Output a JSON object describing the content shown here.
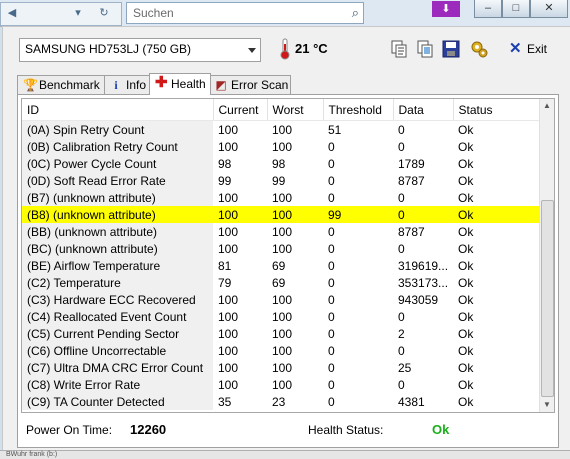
{
  "background": {
    "search_placeholder": "Suchen",
    "bottom_fragment": "BWuhr frank (b:)"
  },
  "toolbar": {
    "drive": "SAMSUNG HD753LJ (750 GB)",
    "temperature": "21 °C",
    "exit_label": "Exit"
  },
  "tabs": [
    {
      "label": "Benchmark",
      "icon": "trophy-icon"
    },
    {
      "label": "Info",
      "icon": "info-icon"
    },
    {
      "label": "Health",
      "icon": "health-cross-icon"
    },
    {
      "label": "Error Scan",
      "icon": "error-scan-icon"
    }
  ],
  "table": {
    "headers": [
      "ID",
      "Current",
      "Worst",
      "Threshold",
      "Data",
      "Status"
    ],
    "rows": [
      {
        "id": "(0A) Spin Retry Count",
        "current": "100",
        "worst": "100",
        "threshold": "51",
        "data": "0",
        "status": "Ok"
      },
      {
        "id": "(0B) Calibration Retry Count",
        "current": "100",
        "worst": "100",
        "threshold": "0",
        "data": "0",
        "status": "Ok"
      },
      {
        "id": "(0C) Power Cycle Count",
        "current": "98",
        "worst": "98",
        "threshold": "0",
        "data": "1789",
        "status": "Ok"
      },
      {
        "id": "(0D) Soft Read Error Rate",
        "current": "99",
        "worst": "99",
        "threshold": "0",
        "data": "8787",
        "status": "Ok"
      },
      {
        "id": "(B7) (unknown attribute)",
        "current": "100",
        "worst": "100",
        "threshold": "0",
        "data": "0",
        "status": "Ok"
      },
      {
        "id": "(B8) (unknown attribute)",
        "current": "100",
        "worst": "100",
        "threshold": "99",
        "data": "0",
        "status": "Ok",
        "highlight": true
      },
      {
        "id": "(BB) (unknown attribute)",
        "current": "100",
        "worst": "100",
        "threshold": "0",
        "data": "8787",
        "status": "Ok"
      },
      {
        "id": "(BC) (unknown attribute)",
        "current": "100",
        "worst": "100",
        "threshold": "0",
        "data": "0",
        "status": "Ok"
      },
      {
        "id": "(BE) Airflow Temperature",
        "current": "81",
        "worst": "69",
        "threshold": "0",
        "data": "319619...",
        "status": "Ok"
      },
      {
        "id": "(C2) Temperature",
        "current": "79",
        "worst": "69",
        "threshold": "0",
        "data": "353173...",
        "status": "Ok"
      },
      {
        "id": "(C3) Hardware ECC Recovered",
        "current": "100",
        "worst": "100",
        "threshold": "0",
        "data": "943059",
        "status": "Ok"
      },
      {
        "id": "(C4) Reallocated Event Count",
        "current": "100",
        "worst": "100",
        "threshold": "0",
        "data": "0",
        "status": "Ok"
      },
      {
        "id": "(C5) Current Pending Sector",
        "current": "100",
        "worst": "100",
        "threshold": "0",
        "data": "2",
        "status": "Ok"
      },
      {
        "id": "(C6) Offline Uncorrectable",
        "current": "100",
        "worst": "100",
        "threshold": "0",
        "data": "0",
        "status": "Ok"
      },
      {
        "id": "(C7) Ultra DMA CRC Error Count",
        "current": "100",
        "worst": "100",
        "threshold": "0",
        "data": "25",
        "status": "Ok"
      },
      {
        "id": "(C8) Write Error Rate",
        "current": "100",
        "worst": "100",
        "threshold": "0",
        "data": "0",
        "status": "Ok"
      },
      {
        "id": "(C9) TA Counter Detected",
        "current": "35",
        "worst": "23",
        "threshold": "0",
        "data": "4381",
        "status": "Ok"
      }
    ]
  },
  "footer": {
    "power_on_label": "Power On Time:",
    "power_on_value": "12260",
    "health_label": "Health Status:",
    "health_value": "Ok"
  },
  "colors": {
    "highlight": "#ffff00",
    "health_ok": "#1ab01a",
    "id_column_bg": "#f0f0f0"
  }
}
